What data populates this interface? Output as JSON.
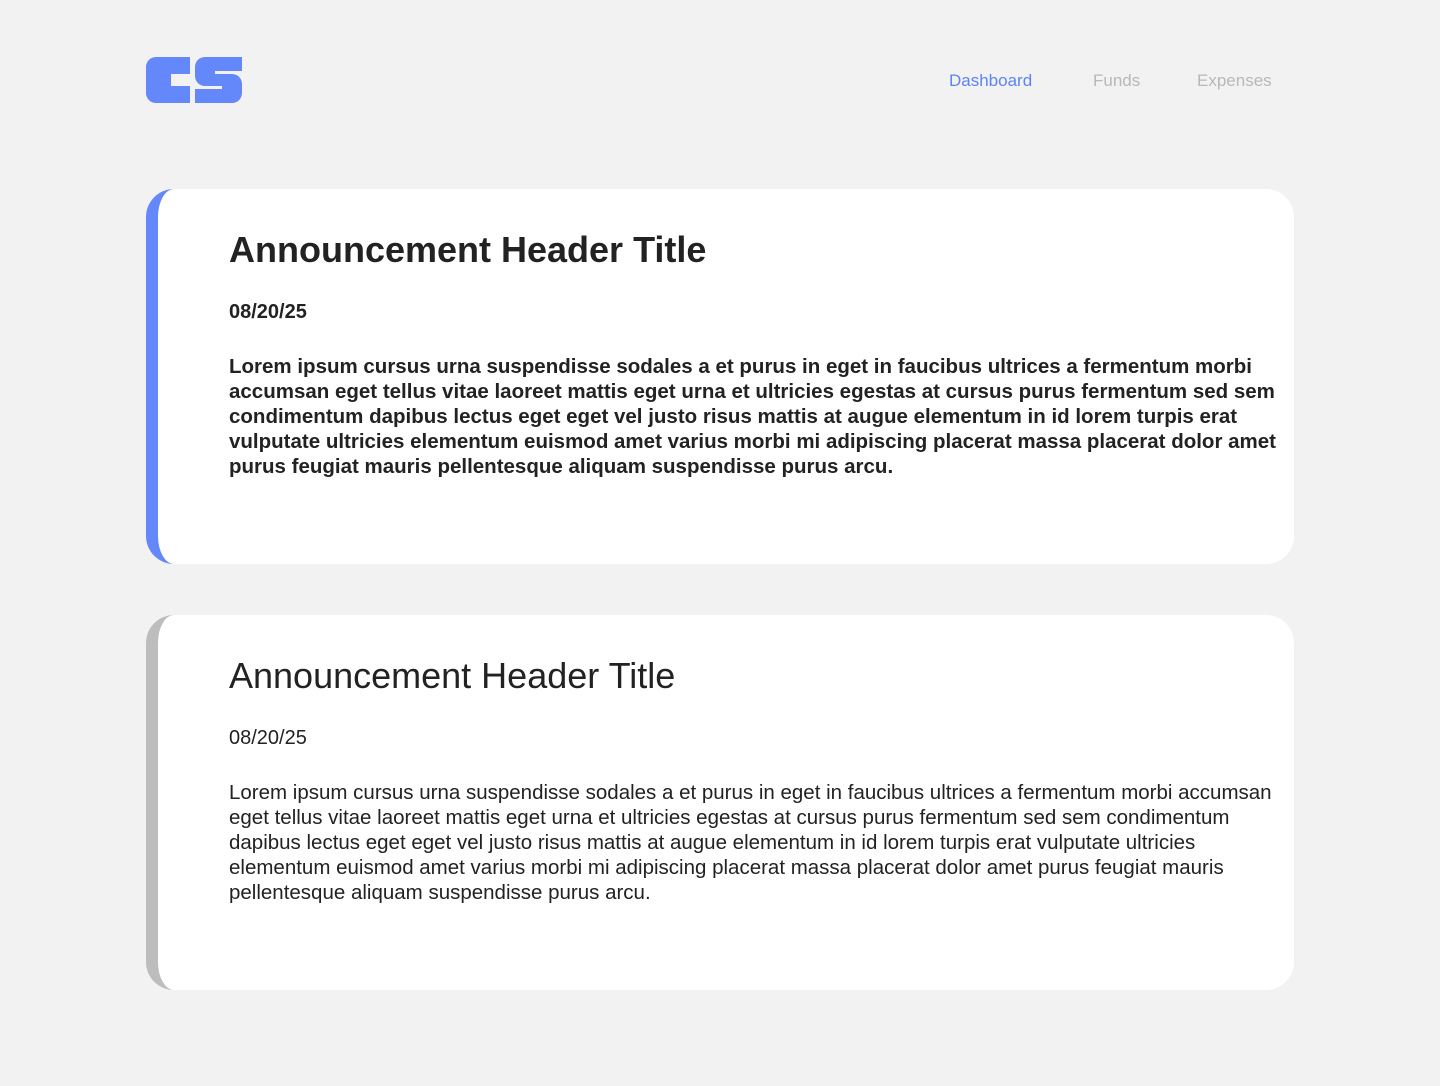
{
  "brand": {
    "logo_text": "CS",
    "accent_color": "#6488f9"
  },
  "nav": {
    "items": [
      {
        "label": "Dashboard",
        "active": true
      },
      {
        "label": "Funds",
        "active": false
      },
      {
        "label": "Expenses",
        "active": false
      }
    ]
  },
  "announcements": [
    {
      "title": "Announcement Header Title",
      "date": "08/20/25",
      "body": "Lorem ipsum cursus urna suspendisse sodales a et purus in eget in faucibus ultrices a fermentum morbi accumsan eget tellus vitae laoreet mattis eget urna et ultricies egestas at cursus purus fermentum sed sem condimentum dapibus lectus eget eget vel justo risus mattis at augue elementum in id lorem turpis erat vulputate ultricies elementum euismod amet varius morbi mi adipiscing placerat massa placerat dolor amet purus feugiat mauris pellentesque aliquam suspendisse purus arcu.",
      "unread": true,
      "stripe_color": "#6488f9"
    },
    {
      "title": "Announcement Header Title",
      "date": "08/20/25",
      "body": "Lorem ipsum cursus urna suspendisse sodales a et purus in eget in faucibus ultrices a fermentum morbi accumsan eget tellus vitae laoreet mattis eget urna et ultricies egestas at cursus purus fermentum sed sem condimentum dapibus lectus eget eget vel justo risus mattis at augue elementum in id lorem turpis erat vulputate ultricies elementum euismod amet varius morbi mi adipiscing placerat massa placerat dolor amet purus feugiat mauris pellentesque aliquam suspendisse purus arcu.",
      "unread": false,
      "stripe_color": "#bdbdbd"
    }
  ]
}
